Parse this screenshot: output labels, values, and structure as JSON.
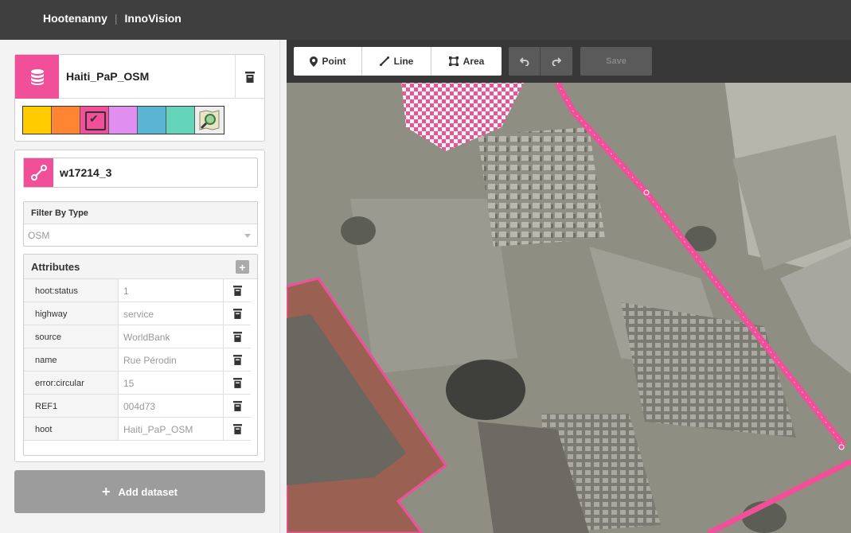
{
  "app": {
    "brand_primary": "Hootenanny",
    "separator": "|",
    "brand_secondary": "InnoVision"
  },
  "dataset": {
    "name": "Haiti_PaP_OSM",
    "icon": "database-icon",
    "palette": [
      {
        "color": "#ffcc00",
        "selected": false
      },
      {
        "color": "#ff8533",
        "selected": false
      },
      {
        "color": "#f14f9a",
        "selected": true
      },
      {
        "color": "#e08ef0",
        "selected": false
      },
      {
        "color": "#5ab4d4",
        "selected": false
      },
      {
        "color": "#63d4b9",
        "selected": false
      }
    ],
    "selected_mark": "✔"
  },
  "feature": {
    "name": "w17214_3",
    "icon": "line-feature-icon",
    "filter_label": "Filter By Type",
    "filter_value": "OSM",
    "attributes_label": "Attributes",
    "add_label": "+",
    "attributes": [
      {
        "key": "hoot:status",
        "value": "1"
      },
      {
        "key": "highway",
        "value": "service"
      },
      {
        "key": "source",
        "value": "WorldBank"
      },
      {
        "key": "name",
        "value": "Rue Pérodin"
      },
      {
        "key": "error:circular",
        "value": "15"
      },
      {
        "key": "REF1",
        "value": "004d73"
      },
      {
        "key": "hoot",
        "value": "Haiti_PaP_OSM"
      }
    ]
  },
  "add_dataset": {
    "plus": "+",
    "label": "Add dataset"
  },
  "toolbar": {
    "point_label": "Point",
    "line_label": "Line",
    "area_label": "Area",
    "save_label": "Save"
  },
  "colors": {
    "accent": "#f14f9a",
    "topbar": "#3f3f3f",
    "toolbar": "#383838"
  }
}
